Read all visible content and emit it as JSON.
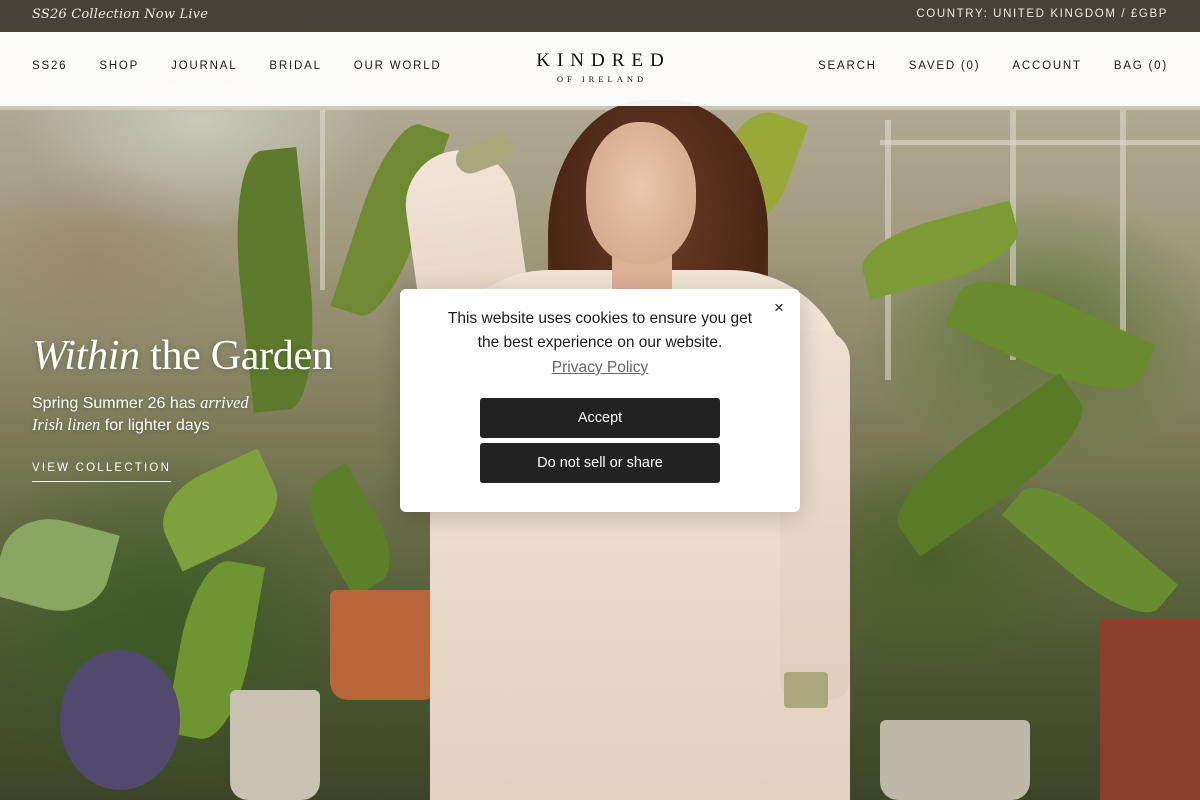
{
  "announcement": {
    "left_text": "SS26 Collection Now Live",
    "right_text": "COUNTRY: UNITED KINGDOM / £GBP"
  },
  "nav": {
    "left_items": [
      "SS26",
      "SHOP",
      "JOURNAL",
      "BRIDAL",
      "OUR WORLD"
    ],
    "logo_main": "KINDRED",
    "logo_sub": "OF IRELAND",
    "right_items": [
      "SEARCH",
      "SAVED (0)",
      "ACCOUNT",
      "BAG (0)"
    ]
  },
  "hero": {
    "title_italic": "Within",
    "title_rest": " the Garden",
    "sub_line1_plain": "Spring Summer 26 has ",
    "sub_line1_italic": "arrived",
    "sub_line2_italic": "Irish linen",
    "sub_line2_plain": " for lighter days",
    "cta_label": "VIEW COLLECTION"
  },
  "cookie_modal": {
    "message": "This website uses cookies to ensure you get the best experience on our website.",
    "privacy_link": "Privacy Policy",
    "accept_label": "Accept",
    "do_not_sell_label": "Do not sell or share",
    "close_glyph": "×"
  },
  "colors": {
    "announcement_bg": "#37322a",
    "button_bg": "#222222",
    "nav_bg": "#ffffff"
  }
}
